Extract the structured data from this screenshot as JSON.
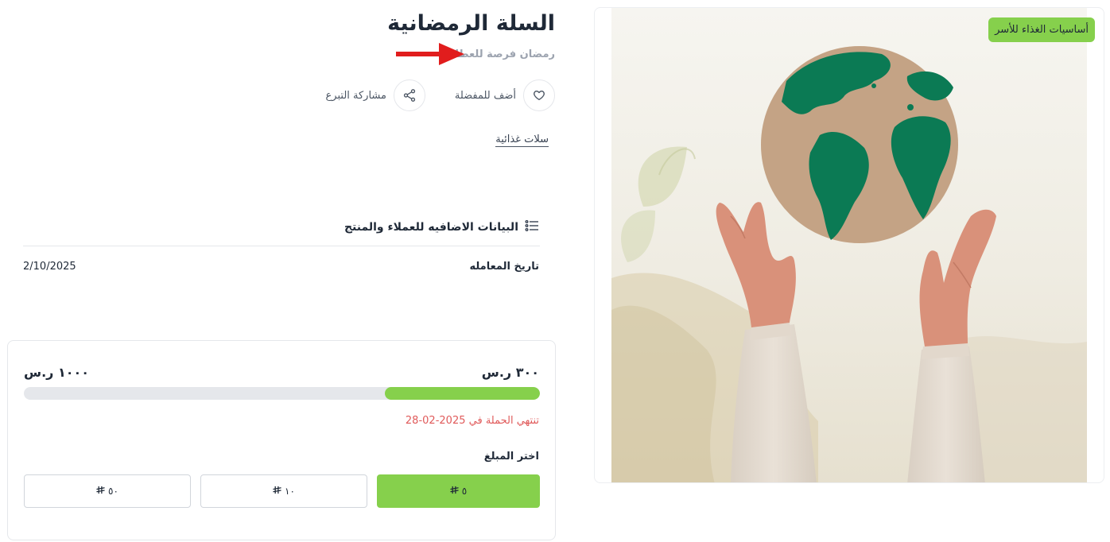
{
  "product": {
    "title": "السلة الرمضانية",
    "subtitle": "رمضان فرصة للعطاء",
    "category": "سلات غذائية",
    "badge": "أساسيات الغذاء للأسر"
  },
  "actions": {
    "favorite_label": "أضف للمفضلة",
    "share_label": "مشاركة التبرع"
  },
  "details": {
    "section_title": "البيانات الاضافيه للعملاء والمنتج",
    "rows": [
      {
        "label": "تاريخ المعامله",
        "value": "2/10/2025"
      }
    ]
  },
  "donation": {
    "collected": "٣٠٠ ر.س",
    "target": "١٠٠٠ ر.س",
    "progress_fraction": 0.3,
    "ends_text": "تنتهي الحملة في 2025-02-28",
    "choose_label": "اختر المبلغ",
    "amounts": [
      {
        "value": "٥",
        "selected": true
      },
      {
        "value": "١٠",
        "selected": false
      },
      {
        "value": "٥٠",
        "selected": false
      }
    ]
  },
  "colors": {
    "accent": "#86d04c",
    "deadline": "#e05a5a",
    "arrow": "#e11d1d"
  },
  "icons": {
    "favorite": "heart-icon",
    "share": "share-icon",
    "section": "list-icon",
    "currency": "riyal-icon"
  }
}
